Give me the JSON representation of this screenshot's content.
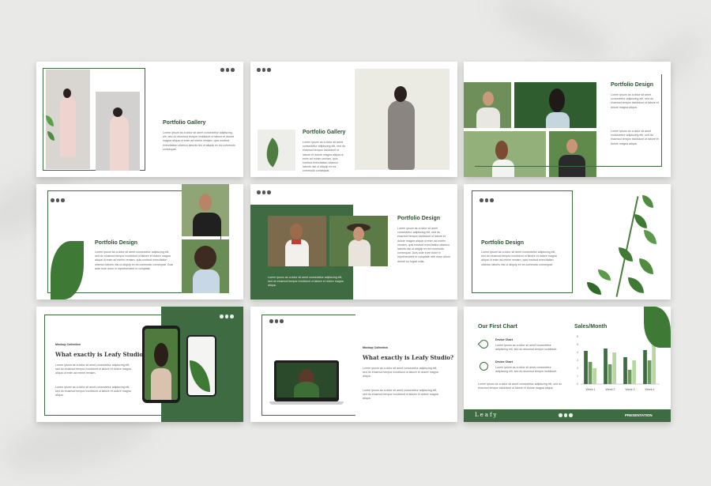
{
  "slide1": {
    "title": "Portfolio Gallery",
    "body": "Lorem ipsum as a dolor sit amet consectetur adipiscing elit, sed do eiusmod tempor incididunt ut labore et dolore magna aliqua ut enim ad minim veniam, quis nostrud exercitation ullamco laboris nisi ut aliquip ex ea commodo consequat."
  },
  "slide2": {
    "title": "Portfolio Gallery",
    "body": "Lorem ipsum as a dolor sit amet consectetur adipiscing elit, sed do eiusmod tempor incididunt ut labore et dolore magna aliqua ut enim ad minim veniam, quis nostrud exercitation ullamco laboris nisi ut aliquip ex ea commodo consequat."
  },
  "slide3": {
    "title": "Portfolio Design",
    "bullets": [
      "Lorem ipsum as a dolor sit amet consectetur adipiscing elit, sed do eiusmod tempor incididunt ut labore et dolore magna aliqua.",
      "Lorem ipsum as a dolor sit amet consectetur adipiscing elit, sed do eiusmod tempor incididunt ut labore et dolore magna aliqua."
    ]
  },
  "slide4": {
    "title": "Portfolio Design",
    "body": "Lorem ipsum as a dolor sit amet consectetur adipiscing elit, sed do eiusmod tempor incididunt ut labore et dolore magna aliqua ut enim ad minim veniam, quis nostrud exercitation ullamco laboris nisi ut aliquip ex ea commodo consequat. Duis aute irure dolor in reprehenderit in voluptate."
  },
  "slide5": {
    "title": "Portfolio Design",
    "body": "Lorem ipsum as a dolor sit amet consectetur adipiscing elit, sed do eiusmod tempor incididunt ut labore et dolore magna aliqua ut enim ad minim veniam, quis nostrud exercitation ullamco laboris nisi ut aliquip ex ea commodo consequat. Duis aute irure dolor in reprehenderit in voluptate velit esse cillum dolore eu fugiat nulla.",
    "caption": "Lorem ipsum as a dolor sit amet consectetur adipiscing elit, sed do eiusmod tempor incididunt ut labore et dolore magna aliqua."
  },
  "slide6": {
    "title": "Portfolio Design",
    "body": "Lorem ipsum as a dolor sit amet consectetur adipiscing elit, sed do eiusmod tempor incididunt ut labore et dolore magna aliqua ut enim ad minim veniam, quis nostrud exercitation ullamco laboris nisi ut aliquip ex ea commodo consequat."
  },
  "slide7": {
    "label": "Mockup Collection",
    "title": "What exactly is Leafy Studio?",
    "bullets": [
      "Lorem ipsum as a dolor sit amet consectetur adipiscing elit, sed do eiusmod tempor incididunt ut labore et dolore magna aliqua ut enim ad minim veniam.",
      "Lorem ipsum as a dolor sit amet consectetur adipiscing elit, sed do eiusmod tempor incididunt ut labore et dolore magna aliqua."
    ]
  },
  "slide8": {
    "label": "Mockup Collection",
    "title": "What exactly is Leafy Studio?",
    "bullets": [
      "Lorem ipsum as a dolor sit amet consectetur adipiscing elit, sed do eiusmod tempor incididunt ut labore et dolore magna aliqua.",
      "Lorem ipsum as a dolor sit amet consectetur adipiscing elit, sed do eiusmod tempor incididunt ut labore et dolore magna aliqua."
    ]
  },
  "slide9": {
    "left_title": "Our First Chart",
    "items": [
      {
        "title": "Device Chart",
        "body": "Lorem ipsum as a dolor sit amet consectetur adipiscing elit, sed do eiusmod tempor incididunt."
      },
      {
        "title": "Device Chart",
        "body": "Lorem ipsum as a dolor sit amet consectetur adipiscing elit, sed do eiusmod tempor incididunt."
      }
    ],
    "body": "Lorem ipsum as a dolor sit amet consectetur adipiscing elit, sed do eiusmod tempor incididunt ut labore et dolore magna aliqua.",
    "footer_brand": "Leafy",
    "footer_label": "PRESENTATION"
  },
  "colors": {
    "accent": "#3f6b42",
    "accent_light": "#9cc48a",
    "background": "#e9e9e7"
  },
  "chart_data": {
    "type": "bar",
    "title": "Sales/Month",
    "categories": [
      "Week 1",
      "Week 2",
      "Week 3",
      "Week 4"
    ],
    "series": [
      {
        "values": [
          4.2,
          4.5,
          3.4,
          4.3
        ]
      },
      {
        "values": [
          2.8,
          2.5,
          1.8,
          3.0
        ]
      },
      {
        "values": [
          2.0,
          4.0,
          3.0,
          5.0
        ]
      }
    ],
    "ylim": [
      0,
      6
    ],
    "yticks": [
      "0",
      "1",
      "2",
      "3",
      "4",
      "5",
      "6"
    ],
    "series_colors": [
      "#3f6b42",
      "#6f9a5f",
      "#b6d7a0"
    ]
  }
}
